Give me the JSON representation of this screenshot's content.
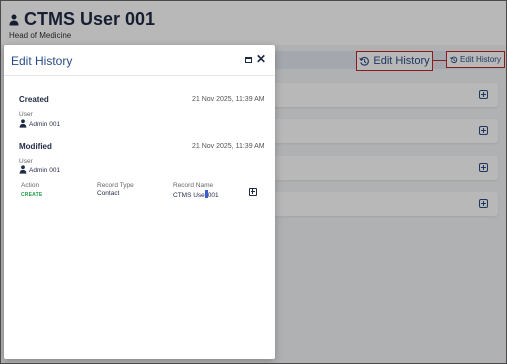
{
  "page": {
    "title": "CTMS User 001",
    "subtitle": "Head of Medicine",
    "edit_history_label": "Edit History",
    "edit_history_small_label": "Edit History"
  },
  "modal": {
    "title": "Edit History",
    "created": {
      "title": "Created",
      "date": "21 Nov 2025, 11:39 AM",
      "user_label": "User",
      "user_value": "Admin 001"
    },
    "modified": {
      "title": "Modified",
      "date": "21 Nov 2025, 11:39 AM",
      "user_label": "User",
      "user_value": "Admin 001",
      "columns": {
        "action": "Action",
        "record_type": "Record Type",
        "record_name": "Record Name"
      },
      "row": {
        "action": "CREATE",
        "record_type": "Contact",
        "record_name_before_cursor": "CTMS Use",
        "record_name_after_cursor": "001"
      }
    }
  },
  "icons": {
    "page_user": "person-icon",
    "history": "history-icon",
    "maximize": "maximize-icon",
    "close": "close-icon",
    "expand": "plus-square-icon"
  },
  "colors": {
    "accent": "#2a4c86",
    "highlight_border": "#c0282d",
    "create_action": "#1e9c4a"
  }
}
